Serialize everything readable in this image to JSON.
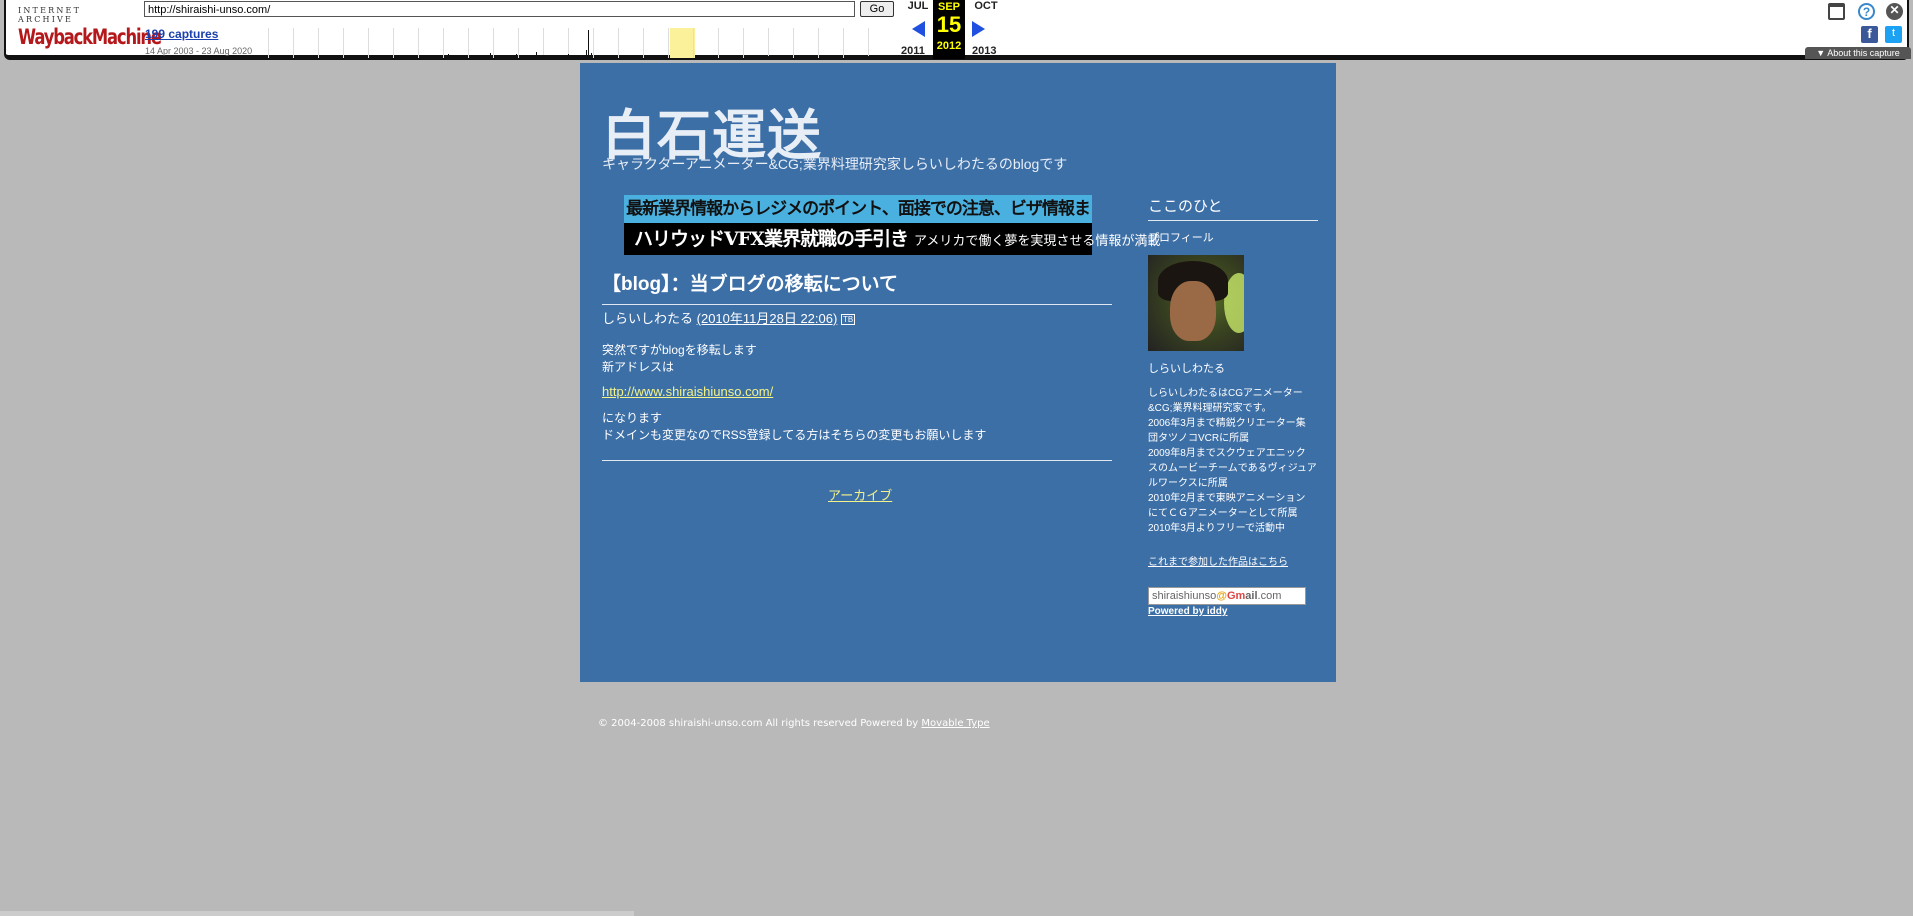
{
  "wayback": {
    "logo_top": "INTERNET ARCHIVE",
    "logo_main": "WaybackMachine",
    "url_value": "http://shiraishi-unso.com/",
    "go_label": "Go",
    "captures": "199 captures",
    "range": "14 Apr 2003 - 23 Aug 2020",
    "prev_month": "JUL",
    "cur_month": "SEP",
    "next_month": "OCT",
    "cur_day": "15",
    "prev_year": "2011",
    "cur_year": "2012",
    "next_year": "2013",
    "about": "About this capture",
    "help_glyph": "?",
    "close_glyph": "✕",
    "fb_glyph": "f",
    "tw_glyph": "t",
    "accent_color": "#2050e0",
    "icons": [
      "window-icon",
      "help-icon",
      "close-icon",
      "facebook-icon",
      "twitter-icon"
    ]
  },
  "blog": {
    "title": "白石運送",
    "description": "キャラクターアニメーター&CG;業界料理研究家しらいしわたるのblogです",
    "banner_top": "最新業界情報からレジメのポイント、面接での注意、ビザ情報まで",
    "banner_bottom_a": "ハリウッドVFX業界就職の手引き",
    "banner_bottom_b": "アメリカで働く夢を実現させる情報が満載",
    "entry": {
      "title": "【blog】：当ブログの移転について",
      "author": "しらいしわたる",
      "date": "(2010年11月28日 22:06)",
      "tb_icon": "TB",
      "line1": "突然ですがblogを移転します",
      "line2": "新アドレスは",
      "link": "http://www.shiraishiunso.com/",
      "line3": "になります",
      "line4": "ドメインも変更なのでRSS登録してる方はそちらの変更もお願いします"
    },
    "archive_link": "アーカイブ",
    "sidebar": {
      "heading": "ここのひと",
      "profile_label": "プロフィール",
      "name": "しらいしわたる",
      "bio": [
        "しらいしわたるはCGアニメーター",
        "&CG;業界料理研究家です。",
        "2006年3月まで精鋭クリエーター集",
        "団タツノコVCRに所属",
        "2009年8月までスクウェアエニック",
        "スのムービーチームであるヴィジュア",
        "ルワークスに所属",
        "2010年2月まで東映アニメーション",
        "にてＣＧアニメーターとして所属",
        "2010年3月よりフリーで活動中"
      ],
      "works_link": "これまで参加した作品はこちら",
      "mail_user": "shiraishiunso",
      "mail_at": "@",
      "mail_brand_g": "G",
      "mail_brand_m": "m",
      "mail_brand_rest": "ail",
      "mail_tld": ".com",
      "powered": "Powered by iddy"
    },
    "footer_text": "© 2004-2008 shiraishi-unso.com All rights reserved Powered by ",
    "footer_link": "Movable Type",
    "bg_color": "#3d6fa7",
    "link_color": "#f3f38a"
  }
}
